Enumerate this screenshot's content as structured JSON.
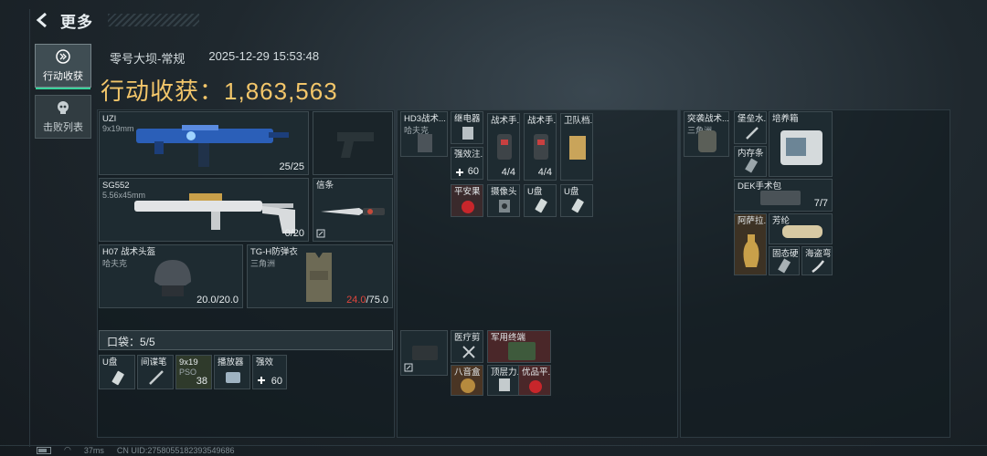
{
  "nav": {
    "back_title": "更多"
  },
  "sidebar": {
    "tabs": [
      {
        "label": "行动收获"
      },
      {
        "label": "击败列表"
      }
    ]
  },
  "header": {
    "map": "零号大坝-常规",
    "datetime": "2025-12-29 15:53:48",
    "loot_label": "行动收获：",
    "loot_value": "1,863,563"
  },
  "loadout": {
    "primary": {
      "name": "UZI",
      "caliber": "9x19mm",
      "ammo": "25/25"
    },
    "secondary": {
      "name": "SG552",
      "caliber": "5.56x45mm",
      "ammo": "0/20"
    },
    "melee": {
      "name": "信条"
    },
    "helmet": {
      "name": "H07 战术头盔",
      "brand": "哈夫克",
      "durability": "20.0/20.0"
    },
    "armor": {
      "name": "TG-H防弹衣",
      "brand": "三角洲",
      "durability_current": "24.0",
      "durability_max": "/75.0"
    },
    "pocket": {
      "label": "口袋：5/5"
    },
    "pocket_items": [
      {
        "name": "U盘",
        "count": ""
      },
      {
        "name": "间谍笔",
        "count": ""
      },
      {
        "name": "9x19",
        "sub": "PSO",
        "count": "38"
      },
      {
        "name": "播放器",
        "count": ""
      },
      {
        "name": "强效",
        "count": "60"
      }
    ]
  },
  "chest_rig": {
    "rig": {
      "name": "HD3战术...",
      "brand": "哈夫克"
    },
    "items": [
      {
        "name": "继电器",
        "count": ""
      },
      {
        "name": "战术手...",
        "count": "4/4"
      },
      {
        "name": "战术手...",
        "count": "4/4"
      },
      {
        "name": "卫队档...",
        "count": ""
      },
      {
        "name": "强效注...",
        "count": "60"
      },
      {
        "name": "平安果",
        "count": ""
      },
      {
        "name": "摄像头",
        "count": ""
      },
      {
        "name": "U盘",
        "count": ""
      },
      {
        "name": "U盘",
        "count": ""
      }
    ]
  },
  "pouch": {
    "items": [
      {
        "name": "医疗剪",
        "count": ""
      },
      {
        "name": "军用终端",
        "count": ""
      },
      {
        "name": "八音盒",
        "count": ""
      },
      {
        "name": "顶层力...",
        "count": ""
      },
      {
        "name": "优品平...",
        "count": ""
      }
    ]
  },
  "backpack": {
    "bag": {
      "name": "突袭战术...",
      "brand": "三角洲"
    },
    "items": [
      {
        "name": "堡垒水...",
        "count": ""
      },
      {
        "name": "培养箱",
        "count": ""
      },
      {
        "name": "内存条",
        "count": ""
      },
      {
        "name": "DEK手术包",
        "count": "7/7"
      },
      {
        "name": "阿萨拉...",
        "count": ""
      },
      {
        "name": "芳纶",
        "count": ""
      },
      {
        "name": "固态硬...",
        "count": ""
      },
      {
        "name": "海盗弯...",
        "count": ""
      }
    ]
  },
  "status_bar": {
    "ping": "37ms",
    "uid": "CN UID:2758055182393549686"
  },
  "colors": {
    "accent": "#f3c66a",
    "tab_underline": "#37d29a",
    "low_durability": "#e0463d",
    "red_rarity": "#5a2a2c"
  }
}
